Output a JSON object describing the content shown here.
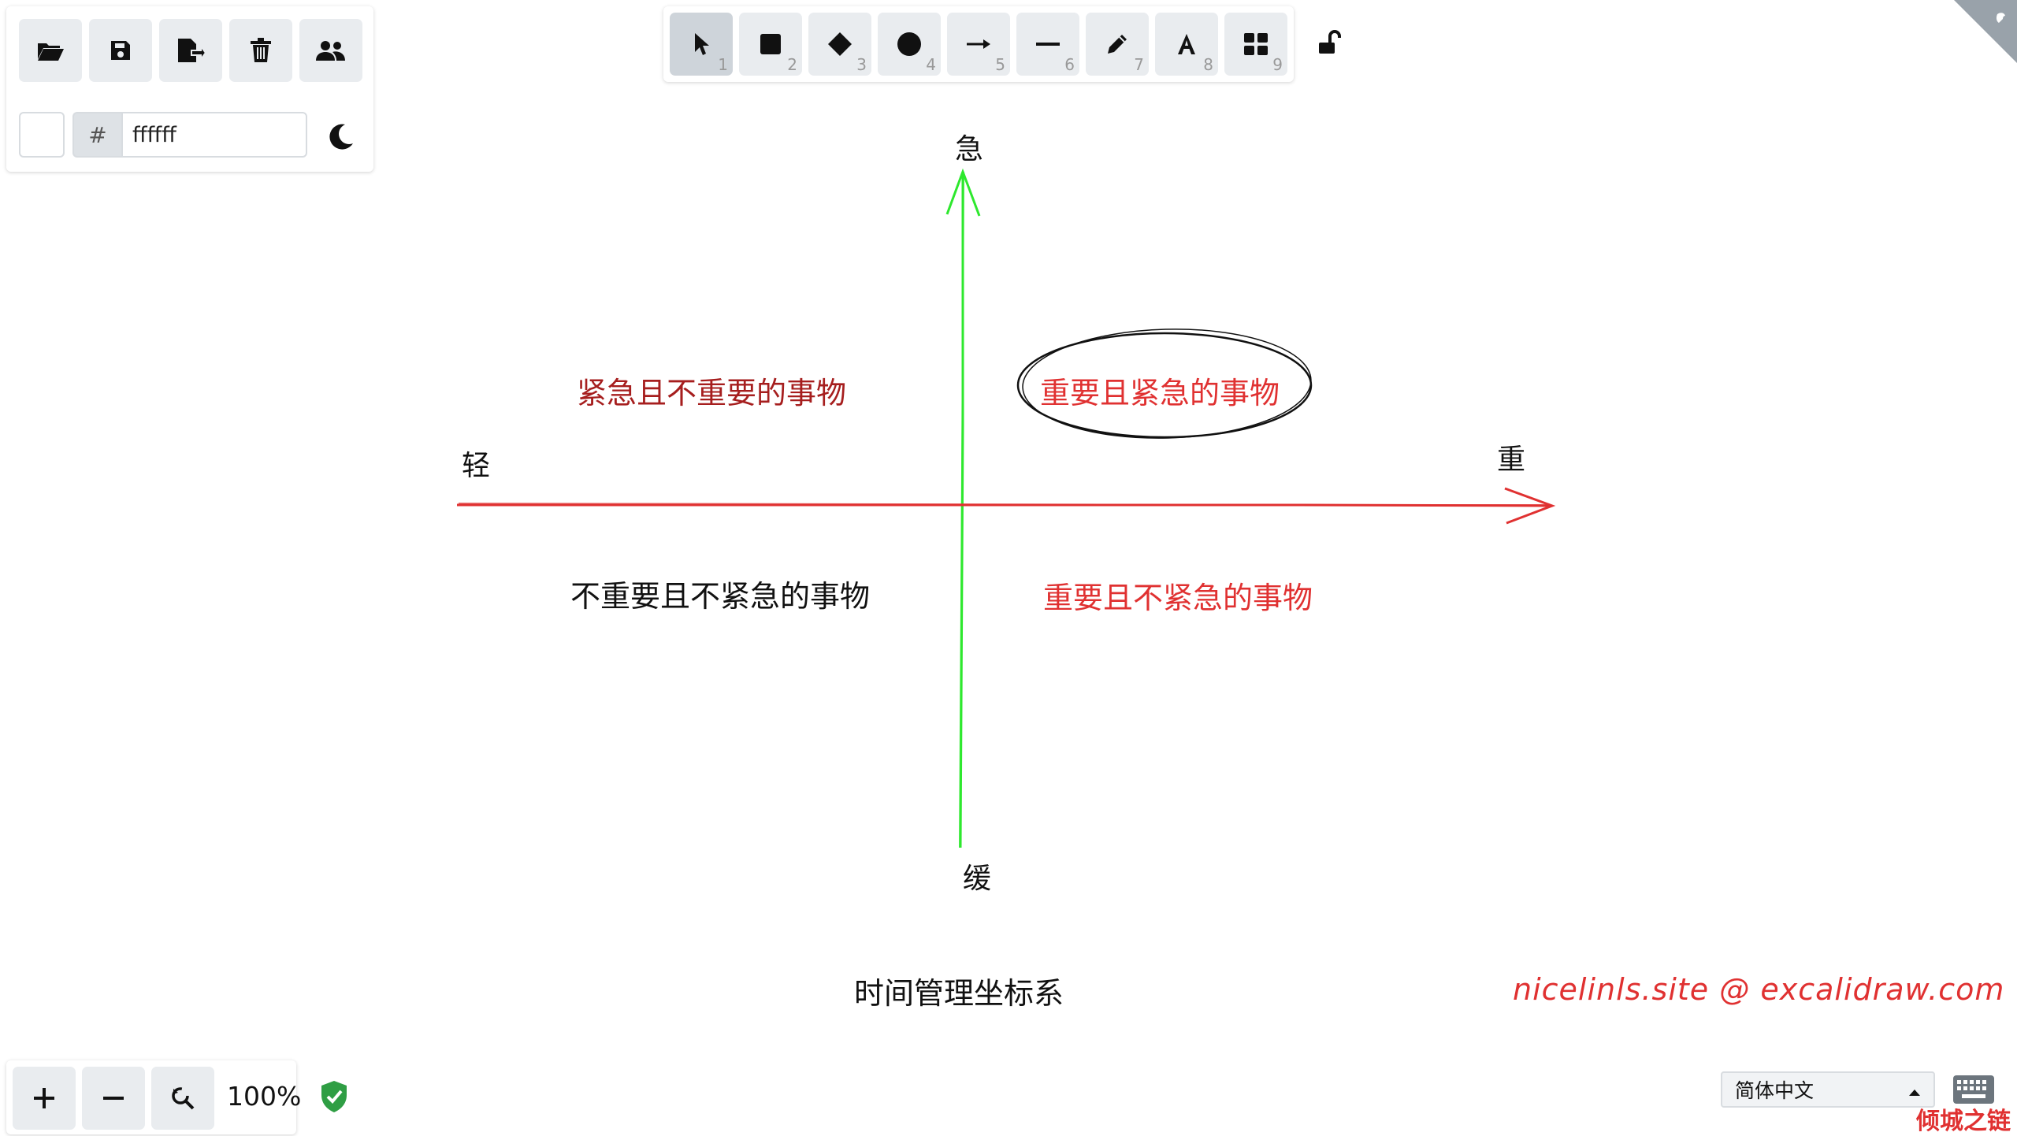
{
  "menu": {
    "open_label": "open-folder-icon",
    "save_label": "save-icon",
    "export_label": "export-icon",
    "delete_label": "trash-icon",
    "collab_label": "users-icon",
    "background_hash": "#",
    "background_value": "ffffff"
  },
  "toolbar": {
    "tools": [
      {
        "name": "selection",
        "icon": "pointer-icon",
        "key": "1",
        "selected": true
      },
      {
        "name": "rectangle",
        "icon": "square-icon",
        "key": "2"
      },
      {
        "name": "diamond",
        "icon": "diamond-icon",
        "key": "3"
      },
      {
        "name": "ellipse",
        "icon": "circle-icon",
        "key": "4"
      },
      {
        "name": "arrow",
        "icon": "arrow-icon",
        "key": "5"
      },
      {
        "name": "line",
        "icon": "line-icon",
        "key": "6"
      },
      {
        "name": "draw",
        "icon": "pencil-icon",
        "key": "7"
      },
      {
        "name": "text",
        "icon": "text-icon",
        "key": "8"
      },
      {
        "name": "library",
        "icon": "grid-icon",
        "key": "9"
      }
    ],
    "lock_icon": "unlock-icon"
  },
  "canvas": {
    "axis_top": "急",
    "axis_bottom": "缓",
    "axis_left": "轻",
    "axis_right": "重",
    "q_top_left": "紧急且不重要的事物",
    "q_top_right": "重要且紧急的事物",
    "q_bottom_left": "不重要且不紧急的事物",
    "q_bottom_right": "重要且不紧急的事物",
    "caption": "时间管理坐标系",
    "signature": "nicelinls.site @ excalidraw.com",
    "colors": {
      "red": "#e03131",
      "dark_red": "#a61e1e",
      "green": "#2ee82e",
      "black": "#111111"
    }
  },
  "zoom": {
    "value": "100%"
  },
  "footer": {
    "language": "简体中文",
    "watermark": "倾城之链"
  }
}
